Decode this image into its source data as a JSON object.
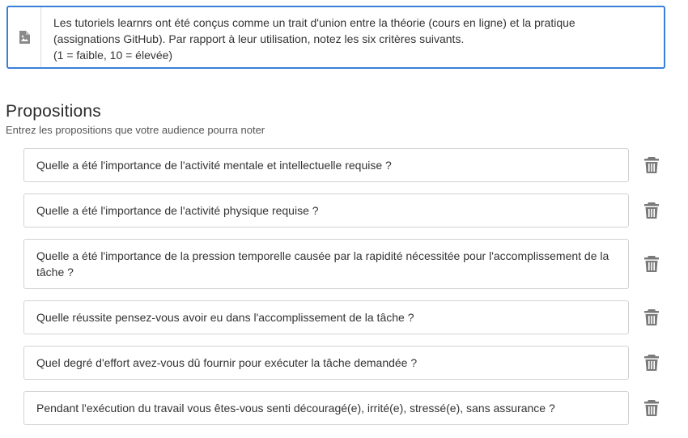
{
  "description": {
    "icon": "image-file-icon",
    "text": "Les tutoriels learnrs ont été conçus comme un trait d'union entre la théorie (cours en ligne) et la pratique\n(assignations GitHub). Par rapport à leur utilisation, notez les six critères suivants.\n(1 = faible, 10 = élevée)"
  },
  "section": {
    "title": "Propositions",
    "subtitle": "Entrez les propositions que votre audience pourra noter"
  },
  "propositions": [
    {
      "text": "Quelle a été l'importance de l'activité mentale et intellectuelle requise ?"
    },
    {
      "text": "Quelle a été l'importance de l'activité physique requise ?"
    },
    {
      "text": "Quelle a été l'importance de la pression temporelle causée par la rapidité nécessitée pour l'accomplissement de la tâche ?"
    },
    {
      "text": "Quelle réussite pensez-vous avoir eu dans l'accomplissement de la tâche ?"
    },
    {
      "text": "Quel degré d'effort avez-vous dû fournir pour exécuter la tâche demandée ?"
    },
    {
      "text": "Pendant l'exécution du travail vous êtes-vous senti découragé(e), irrité(e), stressé(e), sans assurance ?"
    }
  ],
  "icons": {
    "delete": "trash-icon"
  },
  "colors": {
    "focus_border": "#3b7fd9",
    "input_border": "#d2d2d2",
    "icon_gray": "#7a7a7a"
  }
}
